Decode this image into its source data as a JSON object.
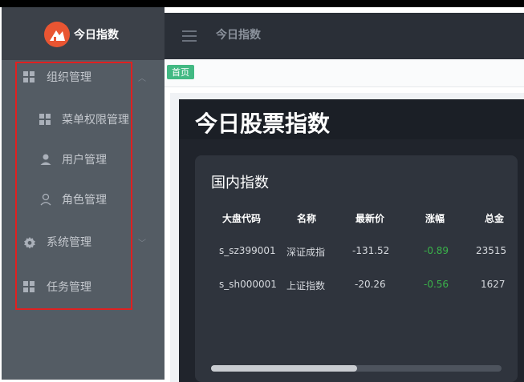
{
  "app": {
    "logo_text": "今日指数"
  },
  "sidebar": {
    "items": [
      {
        "label": "组织管理"
      },
      {
        "label": "菜单权限管理"
      },
      {
        "label": "用户管理"
      },
      {
        "label": "角色管理"
      },
      {
        "label": "系统管理"
      },
      {
        "label": "任务管理"
      }
    ]
  },
  "header": {
    "title": "今日指数"
  },
  "tabs": [
    {
      "label": "首页"
    }
  ],
  "dashboard": {
    "title": "今日股票指数",
    "panel_title": "国内指数",
    "columns": [
      "大盘代码",
      "名称",
      "最新价",
      "涨幅",
      "总金"
    ],
    "rows": [
      {
        "code": "s_sz399001",
        "name": "深证成指",
        "price": "-131.52",
        "change": "-0.89",
        "total": "23515"
      },
      {
        "code": "s_sh000001",
        "name": "上证指数",
        "price": "-20.26",
        "change": "-0.56",
        "total": "1627"
      }
    ],
    "scroll_position": 0.5
  },
  "colors": {
    "sidebar_bg": "#545c64",
    "header_bg": "#2a2f37",
    "tab_active": "#42b983",
    "negative_change": "#3ab34a",
    "highlight_border": "#e02020"
  }
}
